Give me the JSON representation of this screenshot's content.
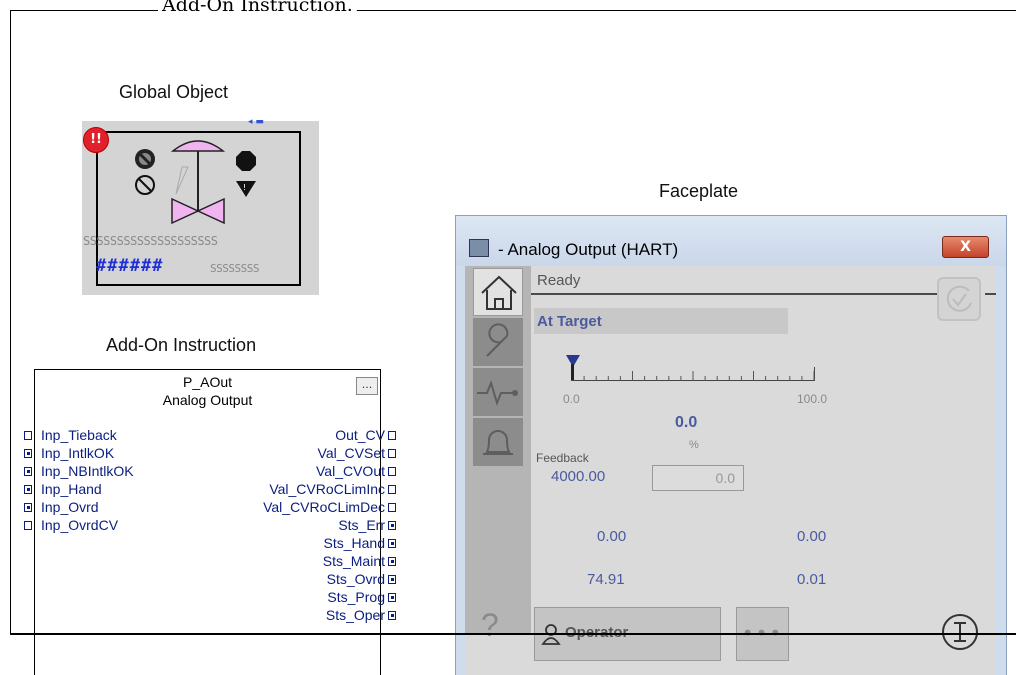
{
  "document": {
    "caption": "Add-On Instruction."
  },
  "labels": {
    "global_object": "Global Object",
    "faceplate": "Faceplate",
    "add_on_instruction": "Add-On Instruction"
  },
  "global_object": {
    "alarm_badge": "!!",
    "s_row_top": "SSSSSSSSSSSSSSSSSSSS",
    "hash_row": "######",
    "s_row_bottom": "SSSSSSSS",
    "colors": {
      "valve": "#f0b4f0",
      "alarm": "#e0202a",
      "hash": "#1e2fd6"
    }
  },
  "aoi": {
    "name": "P_AOut",
    "description": "Analog Output",
    "menu_button": "...",
    "inputs": [
      {
        "label": "Inp_Tieback",
        "connected": false
      },
      {
        "label": "Inp_IntlkOK",
        "connected": true
      },
      {
        "label": "Inp_NBIntlkOK",
        "connected": true
      },
      {
        "label": "Inp_Hand",
        "connected": true
      },
      {
        "label": "Inp_Ovrd",
        "connected": true
      },
      {
        "label": "Inp_OvrdCV",
        "connected": false
      }
    ],
    "outputs": [
      {
        "label": "Out_CV",
        "connected": false
      },
      {
        "label": "Val_CVSet",
        "connected": false
      },
      {
        "label": "Val_CVOut",
        "connected": false
      },
      {
        "label": "Val_CVRoCLimInc",
        "connected": false
      },
      {
        "label": "Val_CVRoCLimDec",
        "connected": false
      },
      {
        "label": "Sts_Err",
        "connected": true
      },
      {
        "label": "Sts_Hand",
        "connected": true
      },
      {
        "label": "Sts_Maint",
        "connected": true
      },
      {
        "label": "Sts_Ovrd",
        "connected": true
      },
      {
        "label": "Sts_Prog",
        "connected": true
      },
      {
        "label": "Sts_Oper",
        "connected": true
      }
    ]
  },
  "faceplate": {
    "title": " - Analog Output (HART)",
    "close": "X",
    "state": "Ready",
    "status": "At Target",
    "scale_min": "0.0",
    "scale_max": "100.0",
    "cv_value": "0.0",
    "cv_units": "%",
    "feedback_label": "Feedback",
    "feedback_value": "4000.00",
    "entry_value": "0.0",
    "row1_left": "0.00",
    "row1_right": "0.00",
    "row2_left": "74.91",
    "row2_right": "0.01",
    "help": "?",
    "operator_button": "Operator",
    "more_button": "•••",
    "pointer_value": 0,
    "sidebar": [
      "home-icon",
      "wrench-icon",
      "trend-icon",
      "bell-icon"
    ]
  }
}
